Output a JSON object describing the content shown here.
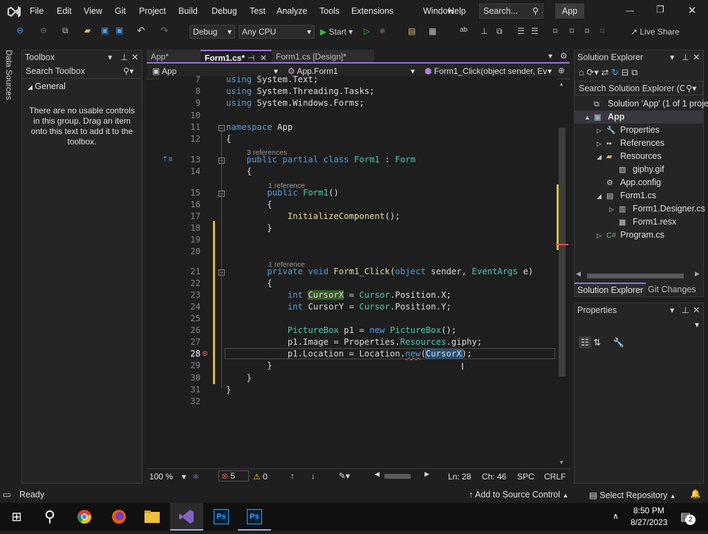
{
  "menu": {
    "items": [
      "File",
      "Edit",
      "View",
      "Git",
      "Project",
      "Build",
      "Debug",
      "Test",
      "Analyze",
      "Tools",
      "Extensions",
      "Window",
      "Help"
    ],
    "search_placeholder": "Search...",
    "app_badge": "App"
  },
  "toolbar": {
    "config": "Debug",
    "platform": "Any CPU",
    "start_label": "Start",
    "live_share": "Live Share"
  },
  "left_strip": {
    "label": "Data Sources"
  },
  "toolbox": {
    "title": "Toolbox",
    "search_placeholder": "Search Toolbox",
    "group": "General",
    "empty_message": "There are no usable controls in this group. Drag an item onto this text to add it to the toolbox."
  },
  "tabs": [
    {
      "label": "App*"
    },
    {
      "label": "Form1.cs*"
    },
    {
      "label": "Form1.cs [Design]*"
    }
  ],
  "navbar": {
    "project": "App",
    "class": "App.Form1",
    "member": "Form1_Click(object sender, Ev"
  },
  "code": {
    "lines": [
      {
        "n": "7",
        "html": "<span class='kw'>using</span> System.Text;"
      },
      {
        "n": "8",
        "html": "<span class='kw'>using</span> System.Threading.Tasks;"
      },
      {
        "n": "9",
        "html": "<span class='kw'>using</span> System.Windows.Forms;"
      },
      {
        "n": "10",
        "html": ""
      },
      {
        "n": "11",
        "html": "<span class='kw'>namespace</span> App"
      },
      {
        "n": "12",
        "html": "{"
      },
      {
        "n": "13",
        "html": "    <span class='kw'>public</span> <span class='kw'>partial</span> <span class='kw'>class</span> <span class='ty'>Form1</span> : <span class='ty'>Form</span>"
      },
      {
        "n": "14",
        "html": "    {"
      },
      {
        "n": "15",
        "html": "        <span class='kw'>public</span> <span class='ty'>Form1</span>()"
      },
      {
        "n": "16",
        "html": "        {"
      },
      {
        "n": "17",
        "html": "            <span class='fn'>InitializeComponent</span>();"
      },
      {
        "n": "18",
        "html": "        }"
      },
      {
        "n": "19",
        "html": ""
      },
      {
        "n": "20",
        "html": ""
      },
      {
        "n": "21",
        "html": "        <span class='kw'>private</span> <span class='kw'>void</span> <span class='fn'>Form1_Click</span>(<span class='kw'>object</span> sender, <span class='ty'>EventArgs</span> e)"
      },
      {
        "n": "22",
        "html": "        {"
      },
      {
        "n": "23",
        "html": "            <span class='kw'>int</span> <span style='background:#3a5a2a'>CursorX</span> = <span class='ty'>Cursor</span>.Position.X;"
      },
      {
        "n": "24",
        "html": "            <span class='kw'>int</span> CursorY = <span class='ty'>Cursor</span>.Position.Y;"
      },
      {
        "n": "25",
        "html": ""
      },
      {
        "n": "26",
        "html": "            <span class='ty'>PictureBox</span> p1 = <span class='kw'>new</span> <span class='ty'>PictureBox</span>();"
      },
      {
        "n": "27",
        "html": "            p1.Image = Properties.<span class='ty'>Resources</span>.giphy;"
      },
      {
        "n": "28",
        "html": "            p1.Location = Location.<span class='kw' style='text-decoration:underline wavy #e05050'>new</span>(<span style='background:#264f78;outline:1px solid #4a7ab0'>CursorX</span>);"
      },
      {
        "n": "29",
        "html": "        }"
      },
      {
        "n": "30",
        "html": "    }"
      },
      {
        "n": "31",
        "html": "}"
      },
      {
        "n": "32",
        "html": ""
      }
    ],
    "refs": {
      "class": "3 references",
      "ctor": "1 reference",
      "method": "1 reference"
    }
  },
  "editor_status": {
    "zoom": "100 %",
    "errors": "5",
    "warnings": "0",
    "ln": "Ln: 28",
    "ch": "Ch: 46",
    "spc": "SPC",
    "crlf": "CRLF"
  },
  "solution": {
    "title": "Solution Explorer",
    "search_placeholder": "Search Solution Explorer (Ct",
    "items": [
      {
        "label": "Solution 'App' (1 of 1 project",
        "depth": 0,
        "icon": "solution-icon",
        "exp": ""
      },
      {
        "label": "App",
        "depth": 0,
        "icon": "csproj-icon",
        "exp": "▲",
        "bold": true
      },
      {
        "label": "Properties",
        "depth": 1,
        "icon": "wrench-icon",
        "exp": "▷"
      },
      {
        "label": "References",
        "depth": 1,
        "icon": "references-icon",
        "exp": "▷"
      },
      {
        "label": "Resources",
        "depth": 1,
        "icon": "folder-icon",
        "exp": "◢"
      },
      {
        "label": "giphy.gif",
        "depth": 2,
        "icon": "image-icon",
        "exp": ""
      },
      {
        "label": "App.config",
        "depth": 1,
        "icon": "config-icon",
        "exp": ""
      },
      {
        "label": "Form1.cs",
        "depth": 1,
        "icon": "form-icon",
        "exp": "◢"
      },
      {
        "label": "Form1.Designer.cs",
        "depth": 2,
        "icon": "csfile-icon",
        "exp": "▷"
      },
      {
        "label": "Form1.resx",
        "depth": 2,
        "icon": "resx-icon",
        "exp": ""
      },
      {
        "label": "Program.cs",
        "depth": 1,
        "icon": "csharp-icon",
        "exp": "▷"
      }
    ],
    "tab_solution": "Solution Explorer",
    "tab_git": "Git Changes"
  },
  "properties": {
    "title": "Properties"
  },
  "status": {
    "ready": "Ready",
    "add_source": "Add to Source Control",
    "select_repo": "Select Repository",
    "notif_count": "2"
  },
  "taskbar": {
    "time": "8:50 PM",
    "date": "8/27/2023"
  },
  "colors": {
    "accent": "#9474e8",
    "vs_purple": "#8661c5"
  }
}
